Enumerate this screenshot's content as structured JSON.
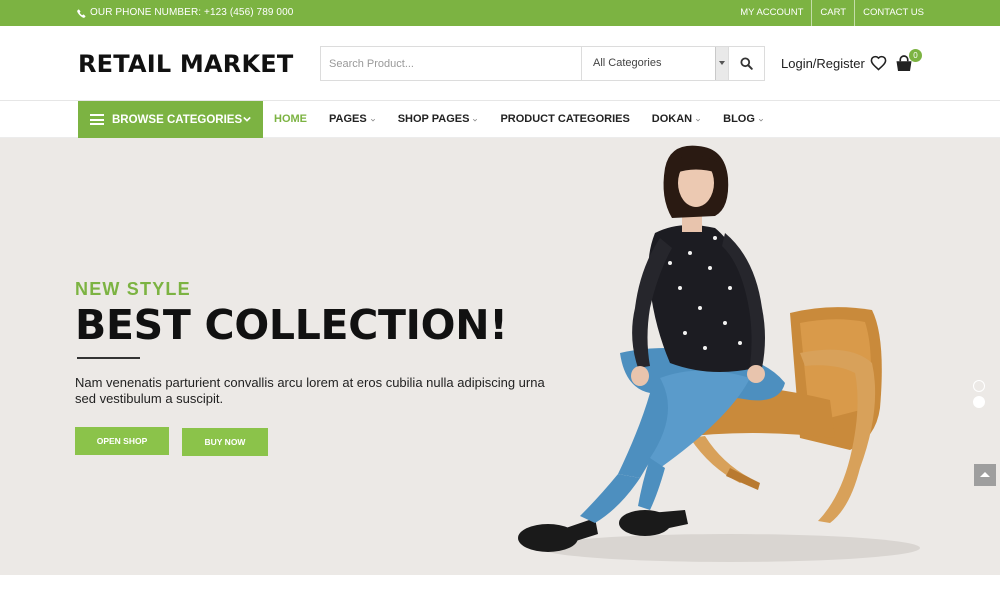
{
  "topbar": {
    "phone_text": "OUR PHONE NUMBER: +123 (456) 789 000",
    "links": [
      "MY ACCOUNT",
      "CART",
      "CONTACT US"
    ]
  },
  "header": {
    "logo": "RETAIL MARKET",
    "search_placeholder": "Search Product...",
    "category_selected": "All Categories",
    "login_text": "Login/Register",
    "cart_count": "0"
  },
  "nav": {
    "browse_label": "BROWSE CATEGORIES",
    "items": [
      {
        "label": "HOME",
        "dropdown": false
      },
      {
        "label": "PAGES",
        "dropdown": true
      },
      {
        "label": "SHOP PAGES",
        "dropdown": true
      },
      {
        "label": "PRODUCT CATEGORIES",
        "dropdown": false
      },
      {
        "label": "DOKAN",
        "dropdown": true
      },
      {
        "label": "BLOG",
        "dropdown": true
      }
    ]
  },
  "hero": {
    "subtitle": "NEW STYLE",
    "title": "BEST COLLECTION!",
    "description": "Nam venenatis parturient convallis arcu lorem at eros cubilia nulla adipiscing urna sed vestibulum a suscipit.",
    "button_open": "OPEN SHOP",
    "button_buy": "BUY NOW"
  },
  "colors": {
    "accent": "#7cb342",
    "hero_bg": "#ece9e6",
    "text_dark": "#111111"
  },
  "icons": [
    "phone-icon",
    "search-icon",
    "heart-icon",
    "shopping-bag-icon",
    "menu-icon",
    "chevron-down-icon",
    "chevron-up-icon"
  ]
}
